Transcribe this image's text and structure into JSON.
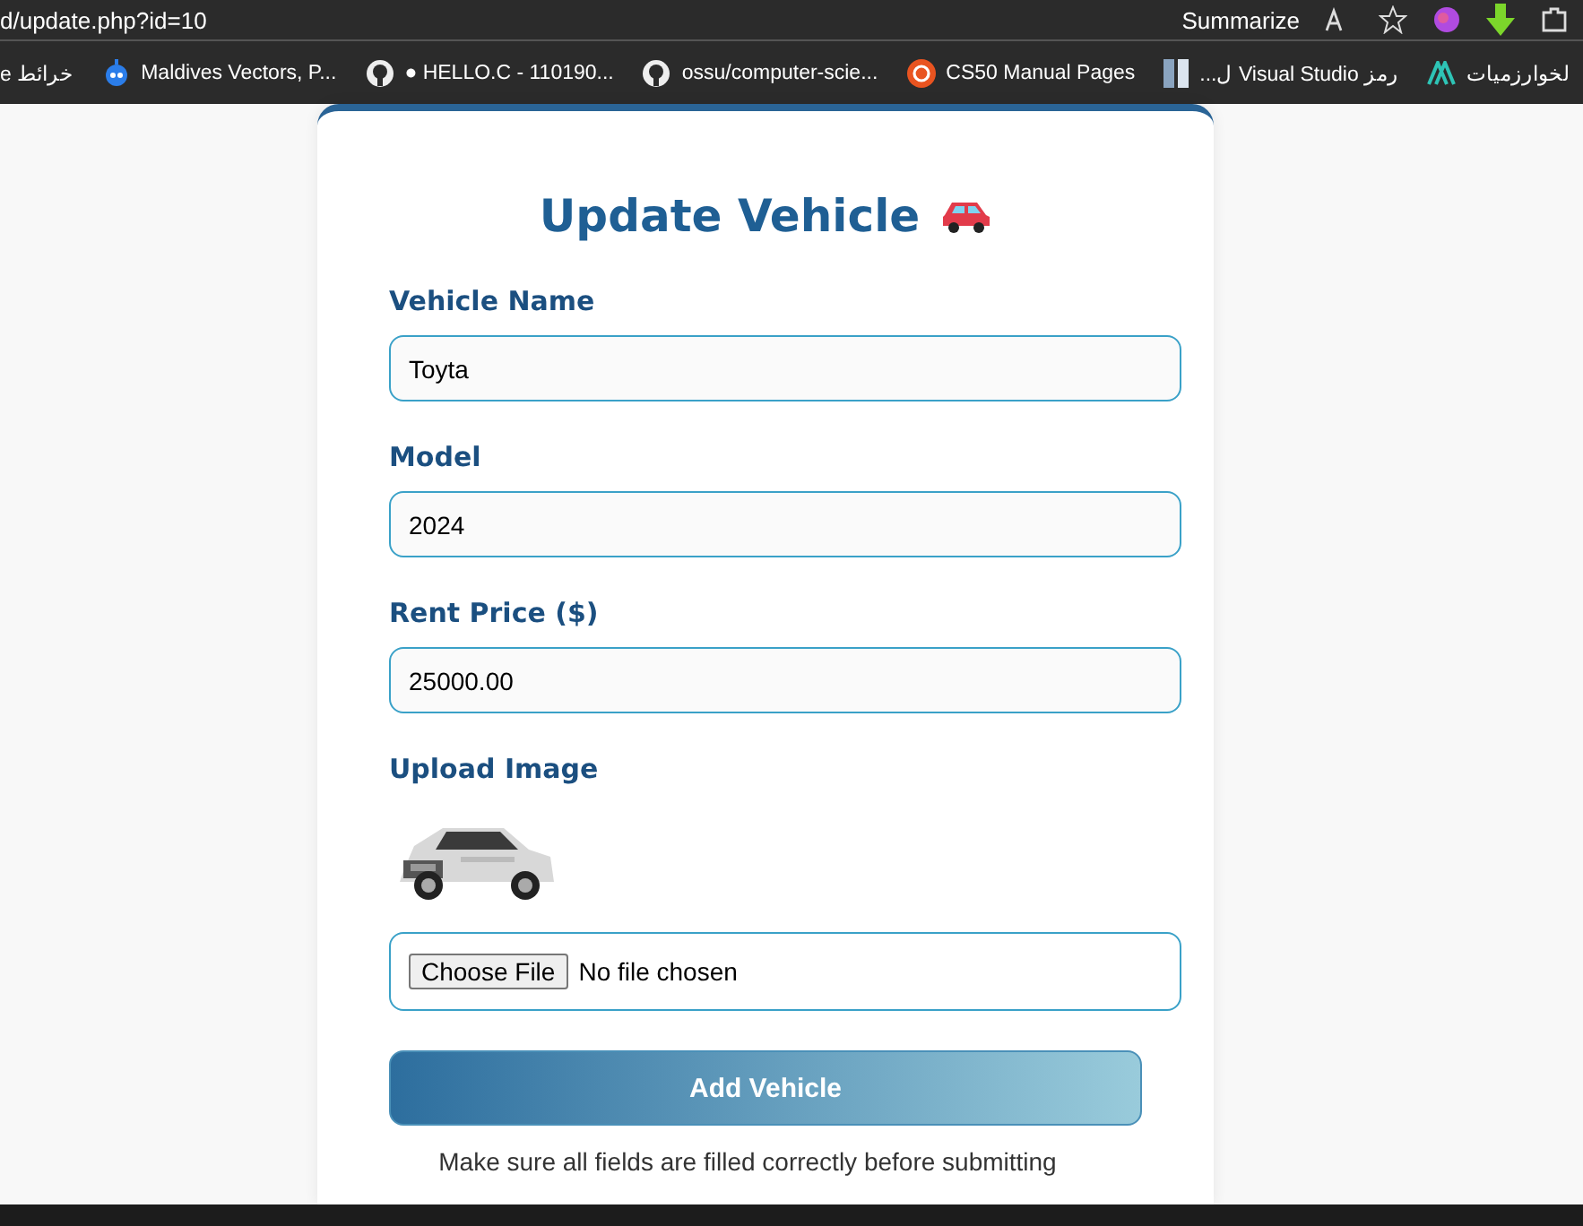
{
  "browser": {
    "address": "d/update.php?id=10",
    "summarize": "Summarize",
    "bookmarks": [
      {
        "label": "e خرائط",
        "kind": "none"
      },
      {
        "label": "Maldives Vectors, P...",
        "kind": "robot"
      },
      {
        "label": "● HELLO.C - 110190...",
        "kind": "github"
      },
      {
        "label": "ossu/computer-scie...",
        "kind": "github"
      },
      {
        "label": "CS50 Manual Pages",
        "kind": "ubuntu"
      },
      {
        "label": "رمز Visual Studio ل...",
        "kind": "panel"
      },
      {
        "label": "لخوارزميات",
        "kind": "logo"
      }
    ]
  },
  "form": {
    "title": "Update Vehicle",
    "fields": [
      {
        "label": "Vehicle Name",
        "kind": "text",
        "value": "Toyta"
      },
      {
        "label": "Model",
        "kind": "text",
        "value": "2024"
      },
      {
        "label": "Rent Price ($)",
        "kind": "text",
        "value": "25000.00"
      },
      {
        "label": "Upload Image",
        "kind": "file",
        "button": "Choose File",
        "status": "No file chosen"
      }
    ],
    "submit": "Add Vehicle",
    "note": "Make sure all fields are filled correctly before submitting"
  }
}
